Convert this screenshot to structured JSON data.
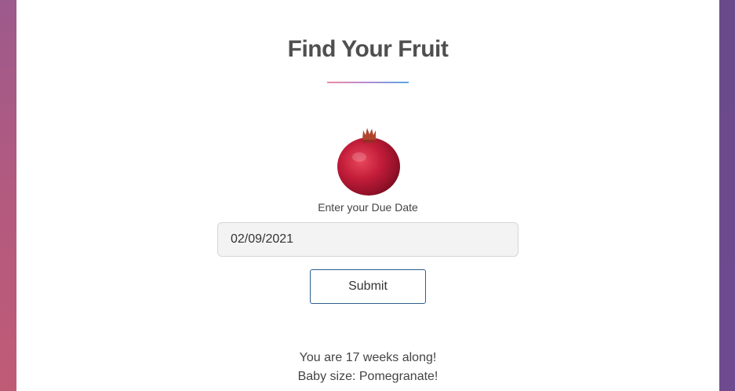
{
  "header": {
    "title": "Find Your Fruit"
  },
  "fruit": {
    "icon": "pomegranate-image"
  },
  "form": {
    "label": "Enter your Due Date",
    "due_date_value": "02/09/2021",
    "submit_label": "Submit"
  },
  "result": {
    "weeks_text": "You are 17 weeks along!",
    "size_text": "Baby size: Pomegranate!"
  },
  "colors": {
    "title": "#4f4f4f",
    "button_border": "#2f5f8f",
    "input_bg": "#f3f3f3",
    "divider_start": "#f08a9e",
    "divider_end": "#5aa8e6"
  }
}
